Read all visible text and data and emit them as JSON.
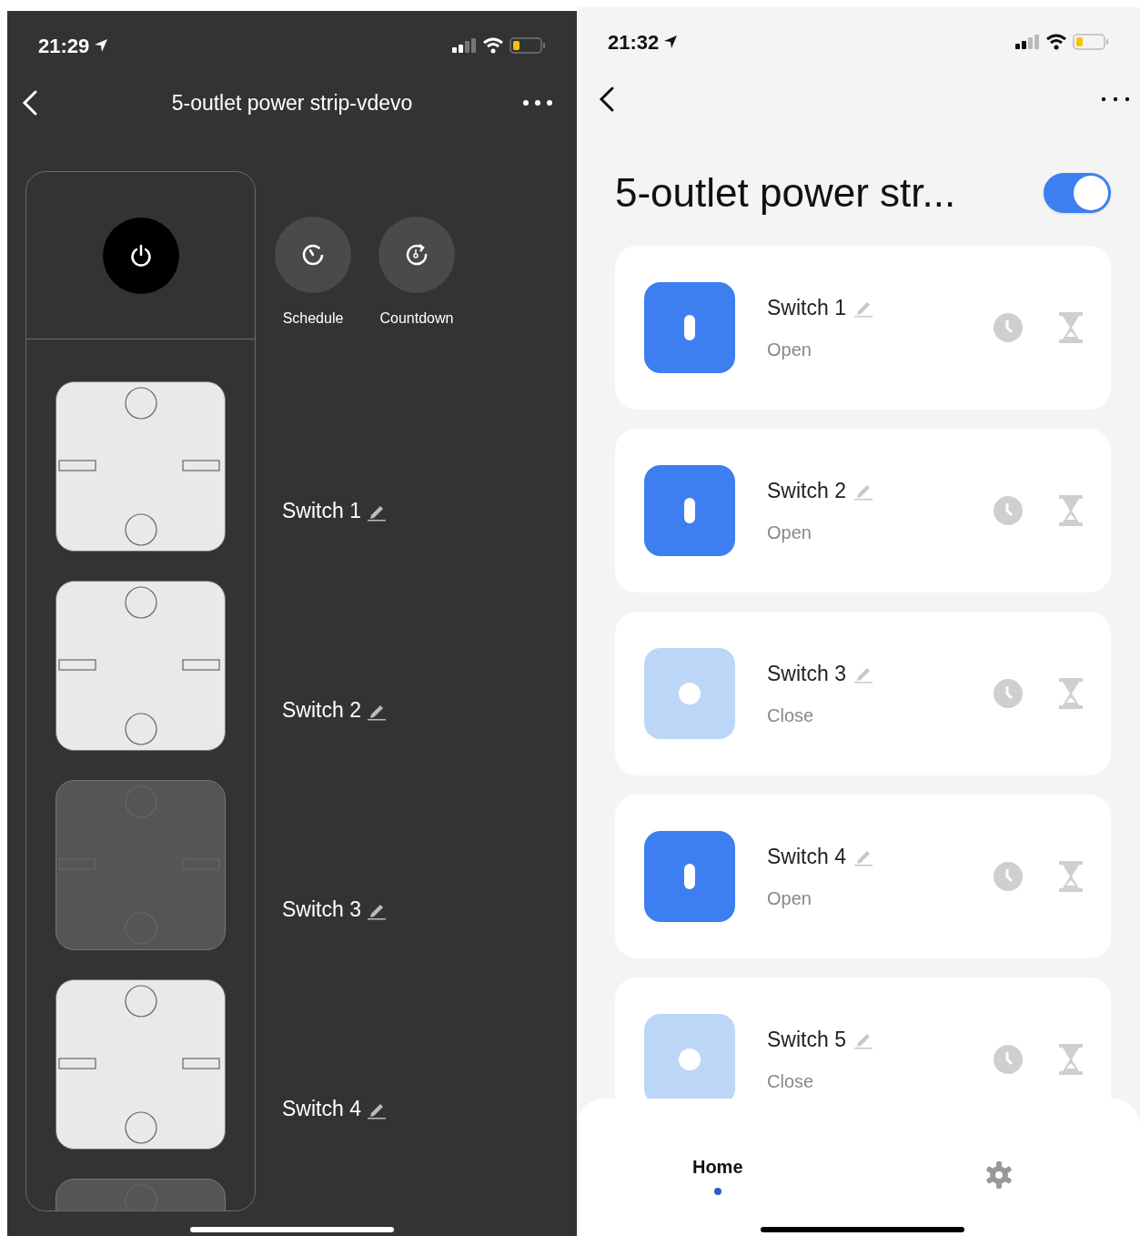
{
  "dark_screen": {
    "status_bar": {
      "time": "21:29"
    },
    "title": "5-outlet power strip-vdevo",
    "actions": [
      {
        "label": "Schedule",
        "kind": "schedule"
      },
      {
        "label": "Countdown",
        "kind": "countdown"
      }
    ],
    "outlets": [
      {
        "label": "Switch 1",
        "on": true
      },
      {
        "label": "Switch 2",
        "on": true
      },
      {
        "label": "Switch 3",
        "on": false
      },
      {
        "label": "Switch 4",
        "on": true
      },
      {
        "on": false
      }
    ]
  },
  "light_screen": {
    "status_bar": {
      "time": "21:32"
    },
    "title": "5-outlet power str...",
    "master_on": true,
    "switches": [
      {
        "name": "Switch 1",
        "status": "Open",
        "on": true
      },
      {
        "name": "Switch 2",
        "status": "Open",
        "on": true
      },
      {
        "name": "Switch 3",
        "status": "Close",
        "on": false
      },
      {
        "name": "Switch 4",
        "status": "Open",
        "on": true
      },
      {
        "name": "Switch 5",
        "status": "Close",
        "on": false
      }
    ],
    "tabs": [
      {
        "label": "Home",
        "selected": true
      },
      {
        "kind": "settings",
        "selected": false
      }
    ]
  }
}
